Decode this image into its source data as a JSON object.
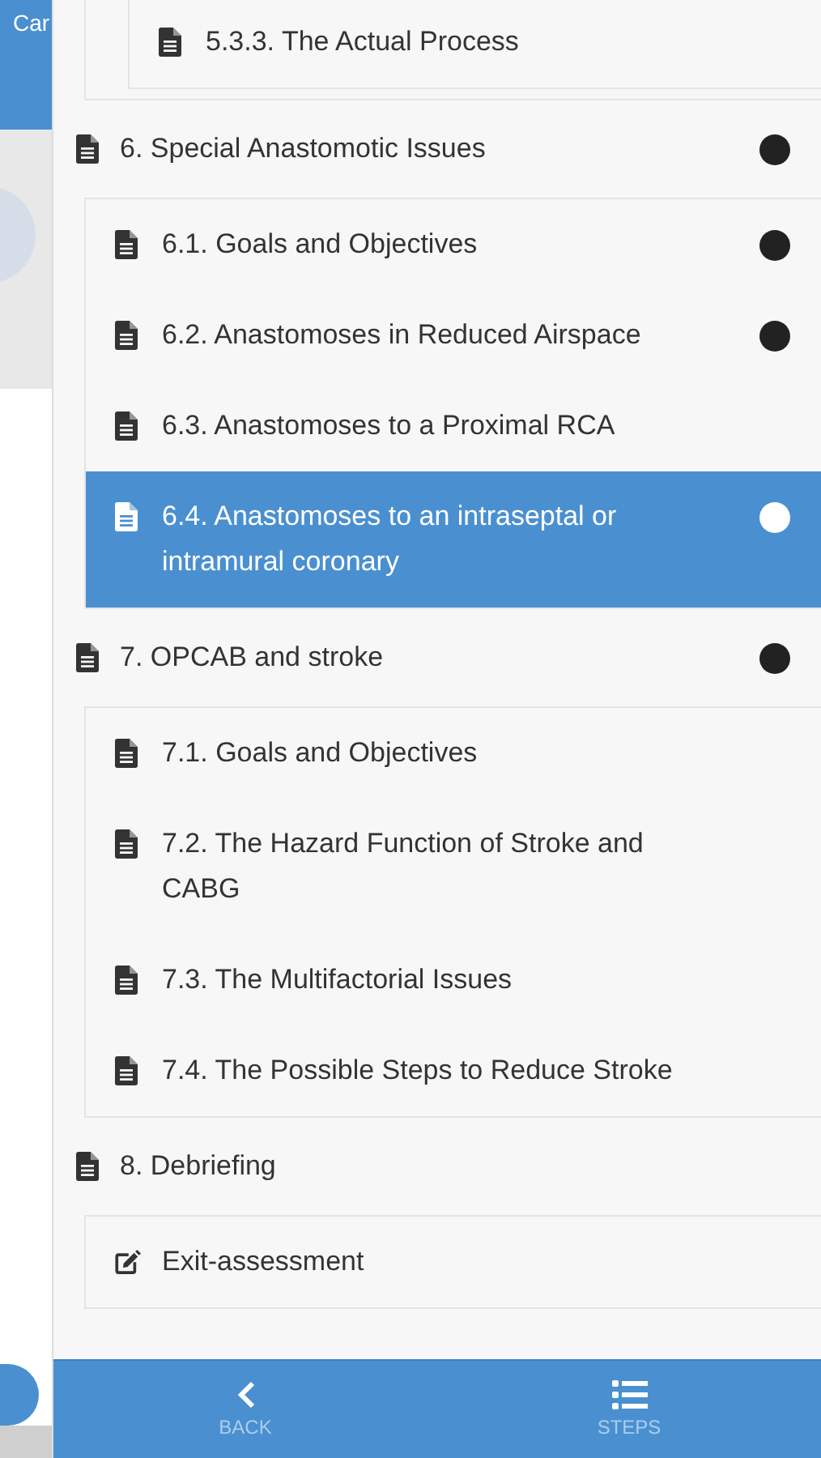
{
  "status_bar": {
    "carrier": "Car"
  },
  "continued_group": {
    "items": [
      {
        "title": "5.3.3. The Actual Process",
        "kind": "document",
        "done": false,
        "selected": false
      }
    ]
  },
  "sections": [
    {
      "title": "6. Special Anastomotic Issues",
      "kind": "document",
      "done": true,
      "children": [
        {
          "title": "6.1. Goals and Objectives",
          "kind": "document",
          "done": true,
          "selected": false
        },
        {
          "title": "6.2. Anastomoses in Reduced Airspace",
          "kind": "document",
          "done": true,
          "selected": false
        },
        {
          "title": "6.3. Anastomoses to a Proximal RCA",
          "kind": "document",
          "done": false,
          "selected": false
        },
        {
          "title": "6.4. Anastomoses to an intraseptal or intramural coronary",
          "kind": "document",
          "done": true,
          "selected": true
        }
      ]
    },
    {
      "title": "7. OPCAB and stroke",
      "kind": "document",
      "done": true,
      "children": [
        {
          "title": "7.1. Goals and Objectives",
          "kind": "document",
          "done": false,
          "selected": false
        },
        {
          "title": "7.2. The Hazard Function of Stroke and CABG",
          "kind": "document",
          "done": false,
          "selected": false
        },
        {
          "title": "7.3. The Multifactorial Issues",
          "kind": "document",
          "done": false,
          "selected": false
        },
        {
          "title": "7.4. The Possible Steps to Reduce Stroke",
          "kind": "document",
          "done": false,
          "selected": false
        }
      ]
    },
    {
      "title": "8. Debriefing",
      "kind": "document",
      "done": false,
      "children": [
        {
          "title": "Exit-assessment",
          "kind": "edit",
          "done": false,
          "selected": false
        }
      ]
    }
  ],
  "nav_bar": [
    {
      "label": "BACK",
      "kind": "back"
    },
    {
      "label": "STEPS",
      "kind": "steps"
    }
  ]
}
